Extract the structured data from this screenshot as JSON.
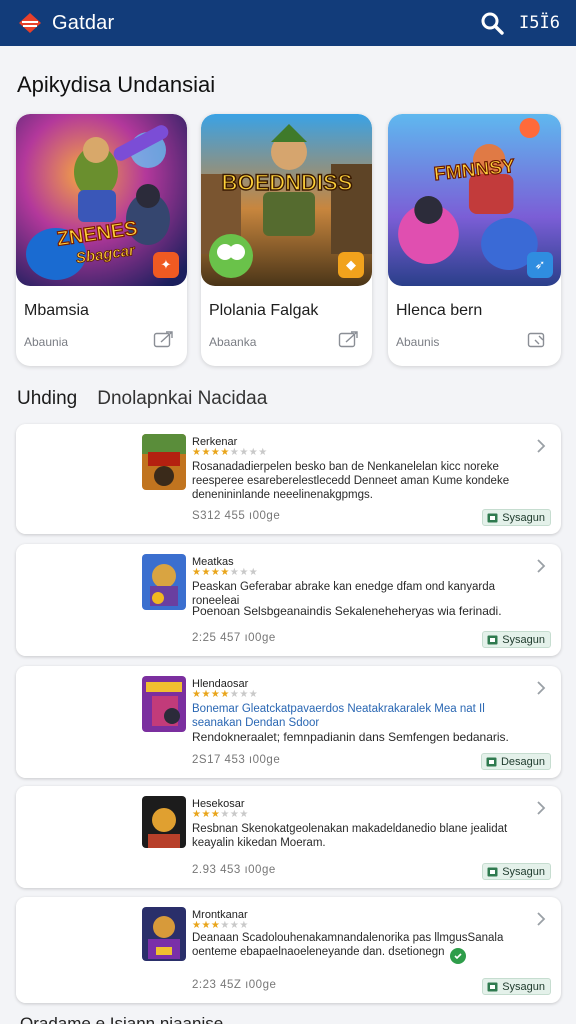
{
  "app": {
    "title": "Gatdar",
    "right_label": "I5Ï6",
    "accent": "#123c7a"
  },
  "icons": {
    "logo": "brand-logo-icon",
    "search": "search-icon",
    "share": "share-icon",
    "chevron": "chevron-right-icon",
    "badge": "download-badge-icon"
  },
  "section": {
    "title": "Apikydisa Undansiai"
  },
  "featured": [
    {
      "title": "Mbamsia",
      "subtitle": "Abaunia",
      "art_text_1": "ZNENES",
      "art_text_2": "Sbagcar",
      "corner_color": "#f05a22"
    },
    {
      "title": "Plolania Falgak",
      "subtitle": "Abaanka",
      "art_text_1": "BOEDNDISS",
      "art_text_2": "",
      "corner_color": "#f1a21c"
    },
    {
      "title": "Hlenca bern",
      "subtitle": "Abaunis",
      "art_text_1": "FMNNSY",
      "art_text_2": "",
      "corner_color": "#2f8de0"
    }
  ],
  "tabs": {
    "first": "Uhding",
    "second": "Dnolapnkai Nacidaa"
  },
  "list": [
    {
      "title": "Rerkenar",
      "stars": "★★★★",
      "stars_off": "★★★★",
      "desc": "Rosanadadierpelen besko ban de Nenkanelelan kicc noreke reesperee esareberelestlecedd Denneet aman Kume kondeke denenininlande neeelinenakgpmgs.",
      "desc2": "",
      "meta": "S312  455  ı00ge",
      "badge": "Sysagun"
    },
    {
      "title": "Meatkas",
      "stars": "★★★★",
      "stars_off": "★★★",
      "desc": "Peaskan Geferabar abrake kan enedge dfam ond kanyarda roneeleai",
      "desc2": "Poenoan Selsbgeanaindis Sekaleneheheryas wia ferinadi.",
      "meta": "2:25  457  ı00ge",
      "badge": "Sysagun"
    },
    {
      "title": "Hlendaosar",
      "stars": "★★★★",
      "stars_off": "★★★",
      "desc": "Bonemar Gleatckatpavaerdos Neatakrakaralek Mea nat Il seanakan Dendan Sdoor",
      "desc2": "Rendokneraalet; femnpadianin dans Semfengen bedanaris.",
      "meta": "2S17  453  ı00ge",
      "badge": "Desagun"
    },
    {
      "title": "Hesekosar",
      "stars": "★★★",
      "stars_off": "★★★",
      "desc": "Resbnan Skenokatgeolenakan makadeldanedio blane jealidat keayalin kikedan Moeram.",
      "desc2": "",
      "meta": "2.93  453  ı00ge",
      "badge": "Sysagun"
    },
    {
      "title": "Mrontkanar",
      "stars": "★★★",
      "stars_off": "★★★",
      "desc": "Deanaan Scadolouhenakamnandalenorika pas llmgusSanala oenteme ebapaelnaoeleneyande dan. dsetionegn",
      "desc2": "",
      "meta": "2:23  45Z  ı00ge",
      "badge": "Sysagun"
    }
  ],
  "bottom": {
    "peek_text": "Oradame e Isiann niaanise"
  }
}
